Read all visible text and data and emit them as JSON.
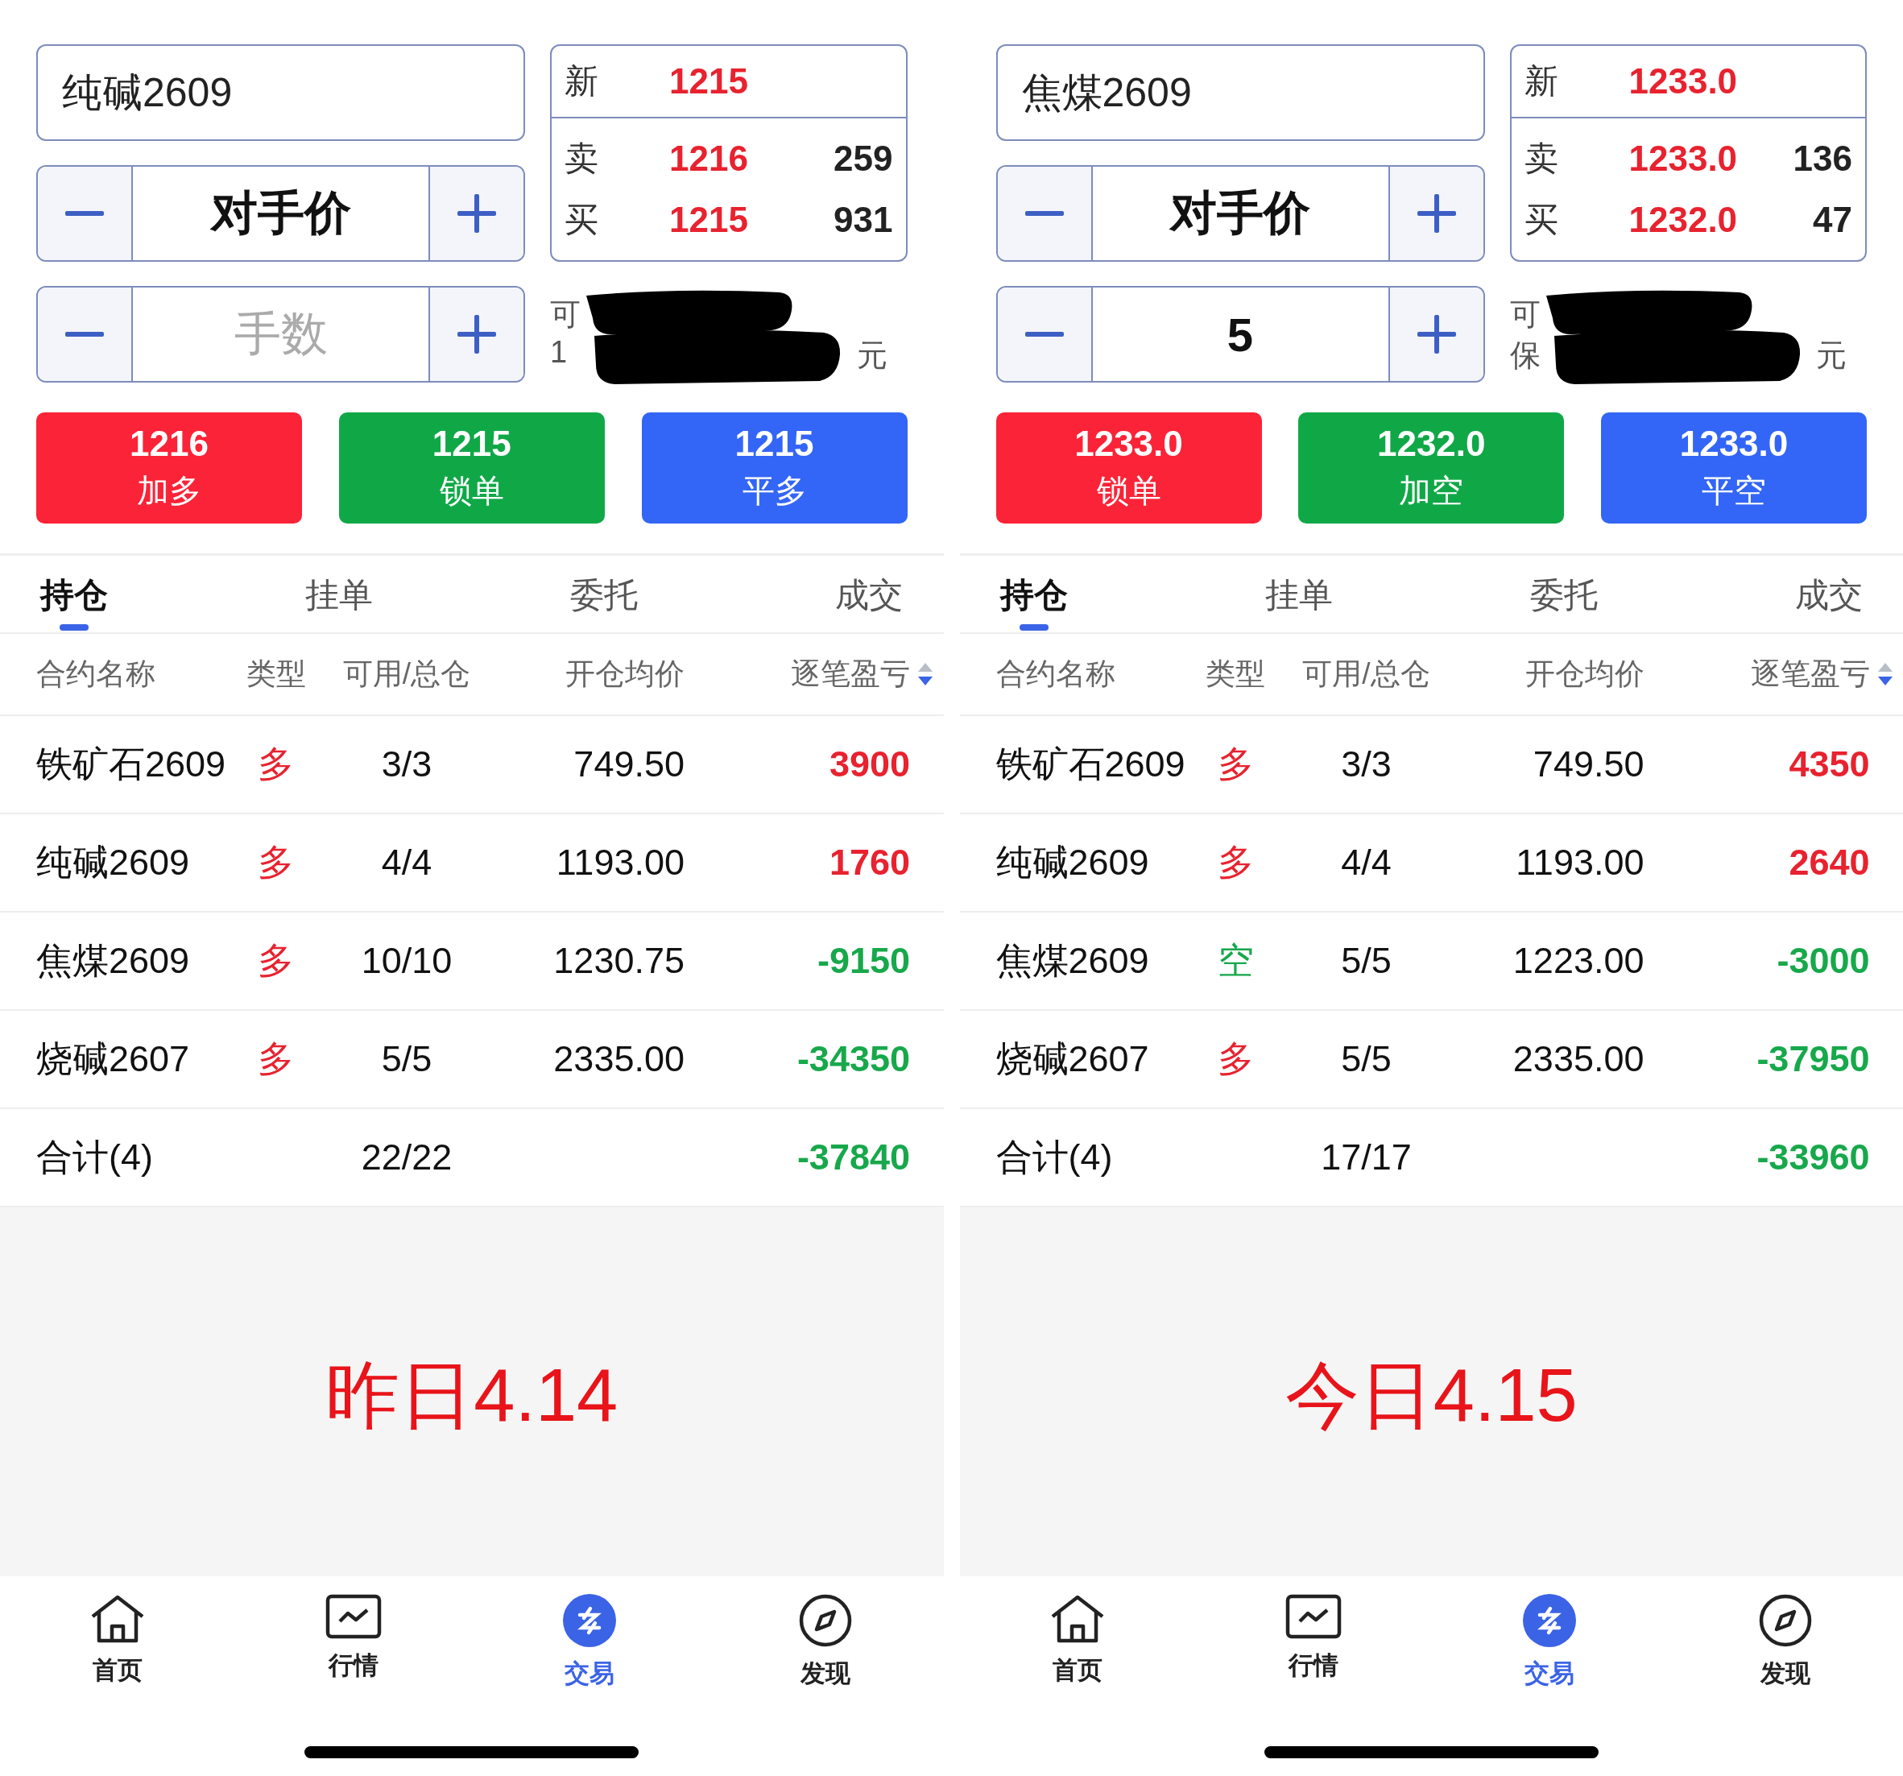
{
  "panels": [
    {
      "contract": "纯碱2609",
      "price_type": "对手价",
      "lots": {
        "placeholder": "手数"
      },
      "quote": {
        "last_label": "新",
        "last": "1215",
        "ask_label": "卖",
        "ask": "1216",
        "ask_volume": "259",
        "bid_label": "买",
        "bid": "1215",
        "bid_volume": "931"
      },
      "account_info": {
        "line_1": "可",
        "line_2": "1",
        "line_2_end": "元"
      },
      "order_buttons": [
        {
          "price": "1216",
          "action": "加多",
          "color": "#fb2337"
        },
        {
          "price": "1215",
          "action": "锁单",
          "color": "#10a847"
        },
        {
          "price": "1215",
          "action": "平多",
          "color": "#3366f6"
        }
      ],
      "tabs": [
        {
          "label": "持仓",
          "selected": true
        },
        {
          "label": "挂单",
          "selected": false
        },
        {
          "label": "委托",
          "selected": false
        },
        {
          "label": "成交",
          "selected": false
        }
      ],
      "columns": [
        {
          "label": "合约名称"
        },
        {
          "label": "类型"
        },
        {
          "label": "可用/总仓"
        },
        {
          "label": "开仓均价"
        },
        {
          "label": "逐笔盈亏"
        }
      ],
      "rows": [
        {
          "name": "铁矿石2609",
          "type": {
            "text": "多",
            "color": "#e8222f"
          },
          "lots": "3/3",
          "avg_price": "749.50",
          "pnl": {
            "text": "3900",
            "color": "#e8222f"
          }
        },
        {
          "name": "纯碱2609",
          "type": {
            "text": "多",
            "color": "#e8222f"
          },
          "lots": "4/4",
          "avg_price": "1193.00",
          "pnl": {
            "text": "1760",
            "color": "#e8222f"
          }
        },
        {
          "name": "焦煤2609",
          "type": {
            "text": "多",
            "color": "#e8222f"
          },
          "lots": "10/10",
          "avg_price": "1230.75",
          "pnl": {
            "text": "-9150",
            "color": "#17a84b"
          }
        },
        {
          "name": "烧碱2607",
          "type": {
            "text": "多",
            "color": "#e8222f"
          },
          "lots": "5/5",
          "avg_price": "2335.00",
          "pnl": {
            "text": "-34350",
            "color": "#17a84b"
          }
        }
      ],
      "total": {
        "label": "合计(4)",
        "lots": "22/22",
        "pnl": "-37840"
      },
      "note": "昨日4.14",
      "nav": [
        {
          "label": "首页",
          "selected": false
        },
        {
          "label": "行情",
          "selected": false
        },
        {
          "label": "交易",
          "selected": true
        },
        {
          "label": "发现",
          "selected": false
        }
      ]
    },
    {
      "contract": "焦煤2609",
      "price_type": "对手价",
      "lots": {
        "value": "5"
      },
      "quote": {
        "last_label": "新",
        "last": "1233.0",
        "ask_label": "卖",
        "ask": "1233.0",
        "ask_volume": "136",
        "bid_label": "买",
        "bid": "1232.0",
        "bid_volume": "47"
      },
      "account_info": {
        "line_1": "可",
        "line_2": "保",
        "line_2_end": "元"
      },
      "order_buttons": [
        {
          "price": "1233.0",
          "action": "锁单",
          "color": "#fb2337"
        },
        {
          "price": "1232.0",
          "action": "加空",
          "color": "#10a847"
        },
        {
          "price": "1233.0",
          "action": "平空",
          "color": "#3366f6"
        }
      ],
      "tabs": [
        {
          "label": "持仓",
          "selected": true
        },
        {
          "label": "挂单",
          "selected": false
        },
        {
          "label": "委托",
          "selected": false
        },
        {
          "label": "成交",
          "selected": false
        }
      ],
      "columns": [
        {
          "label": "合约名称"
        },
        {
          "label": "类型"
        },
        {
          "label": "可用/总仓"
        },
        {
          "label": "开仓均价"
        },
        {
          "label": "逐笔盈亏"
        }
      ],
      "rows": [
        {
          "name": "铁矿石2609",
          "type": {
            "text": "多",
            "color": "#e8222f"
          },
          "lots": "3/3",
          "avg_price": "749.50",
          "pnl": {
            "text": "4350",
            "color": "#e8222f"
          }
        },
        {
          "name": "纯碱2609",
          "type": {
            "text": "多",
            "color": "#e8222f"
          },
          "lots": "4/4",
          "avg_price": "1193.00",
          "pnl": {
            "text": "2640",
            "color": "#e8222f"
          }
        },
        {
          "name": "焦煤2609",
          "type": {
            "text": "空",
            "color": "#17a84b"
          },
          "lots": "5/5",
          "avg_price": "1223.00",
          "pnl": {
            "text": "-3000",
            "color": "#17a84b"
          }
        },
        {
          "name": "烧碱2607",
          "type": {
            "text": "多",
            "color": "#e8222f"
          },
          "lots": "5/5",
          "avg_price": "2335.00",
          "pnl": {
            "text": "-37950",
            "color": "#17a84b"
          }
        }
      ],
      "total": {
        "label": "合计(4)",
        "lots": "17/17",
        "pnl": "-33960"
      },
      "note": "今日4.15",
      "nav": [
        {
          "label": "首页",
          "selected": false
        },
        {
          "label": "行情",
          "selected": false
        },
        {
          "label": "交易",
          "selected": true
        },
        {
          "label": "发现",
          "selected": false
        }
      ]
    }
  ]
}
